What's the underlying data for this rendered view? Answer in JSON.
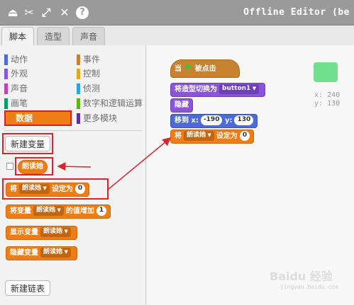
{
  "app_title": "Offline Editor (be",
  "toolbar": {
    "icons": [
      "person-icon",
      "scissors-icon",
      "expand-icon",
      "shrink-icon",
      "help-icon"
    ]
  },
  "tabs": [
    {
      "label": "脚本",
      "active": true
    },
    {
      "label": "造型",
      "active": false
    },
    {
      "label": "声音",
      "active": false
    }
  ],
  "categories": {
    "left": [
      {
        "label": "动作",
        "color": "#4a6cd4"
      },
      {
        "label": "外观",
        "color": "#8a55d7"
      },
      {
        "label": "声音",
        "color": "#bb42c3"
      },
      {
        "label": "画笔",
        "color": "#0e9a6c"
      }
    ],
    "right": [
      {
        "label": "事件",
        "color": "#c88330"
      },
      {
        "label": "控制",
        "color": "#e1a91a"
      },
      {
        "label": "侦测",
        "color": "#2ca5e2"
      },
      {
        "label": "数字和逻辑运算",
        "color": "#5cb712"
      },
      {
        "label": "更多模块",
        "color": "#632d99"
      }
    ],
    "active": "数据"
  },
  "buttons": {
    "new_variable": "新建变量",
    "new_list": "新建链表"
  },
  "variable_name": "朗读她",
  "palette_blocks": {
    "set": {
      "prefix": "将",
      "var": "朗读她",
      "suffix": "设定为",
      "value": "0"
    },
    "change": {
      "prefix": "将变量",
      "var": "朗读她",
      "suffix": "的值增加",
      "value": "1"
    },
    "show": {
      "prefix": "显示变量",
      "var": "朗读她"
    },
    "hide": {
      "prefix": "隐藏变量",
      "var": "朗读她"
    }
  },
  "script_blocks": {
    "hat": {
      "prefix": "当",
      "suffix": "被点击"
    },
    "switch_costume": {
      "prefix": "将造型切换为",
      "value": "button1"
    },
    "hide": "隐藏",
    "goto": {
      "prefix": "移到",
      "x_label": "x:",
      "x": "-190",
      "y_label": "y:",
      "y": "130"
    },
    "set": {
      "prefix": "将",
      "var": "朗读她",
      "suffix": "设定为",
      "value": "0"
    }
  },
  "stage": {
    "x_label": "x:",
    "x": "240",
    "y_label": "y:",
    "y": "130"
  },
  "watermark": {
    "main": "Baidu 经验",
    "sub": "jingyan.baidu.com"
  }
}
